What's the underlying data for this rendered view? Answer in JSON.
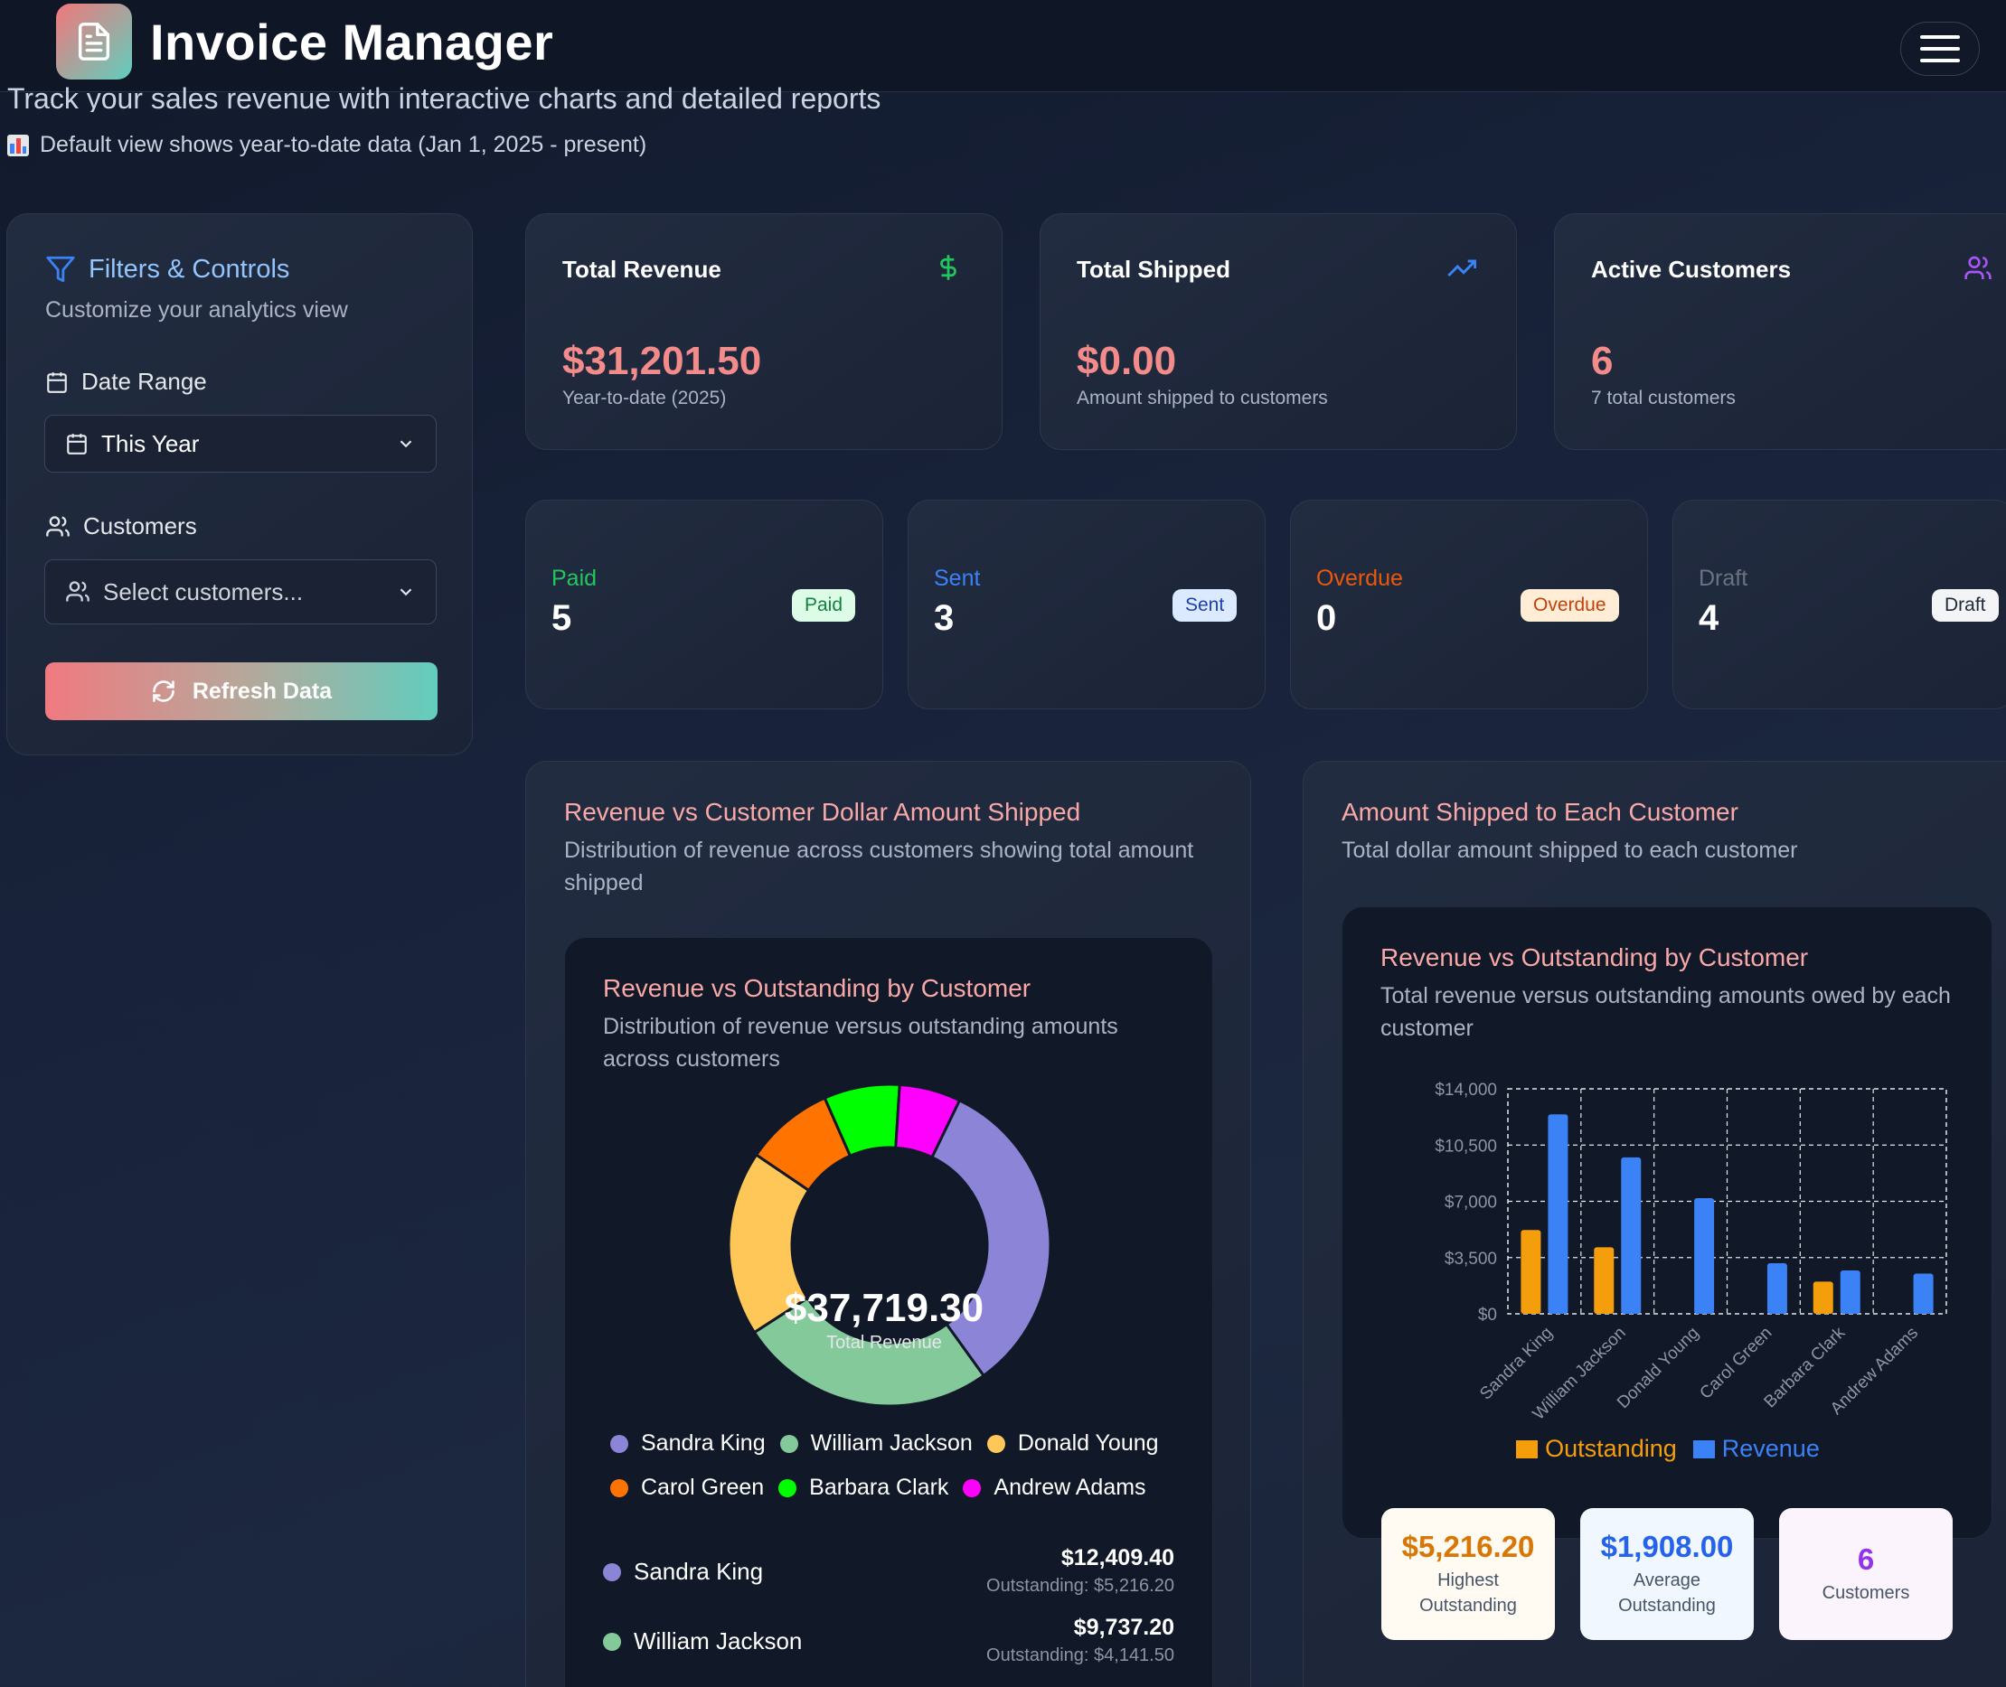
{
  "app": {
    "title": "Invoice Manager"
  },
  "header": {
    "subtitle": "Track your sales revenue with interactive charts and detailed reports",
    "note": "Default view shows year-to-date data (Jan 1, 2025 - present)"
  },
  "filters": {
    "title": "Filters & Controls",
    "subtitle": "Customize your analytics view",
    "date_range_label": "Date Range",
    "date_range_value": "This Year",
    "customers_label": "Customers",
    "customers_placeholder": "Select customers...",
    "refresh_label": "Refresh Data"
  },
  "stats": [
    {
      "title": "Total Revenue",
      "value": "$31,201.50",
      "footer": "Year-to-date (2025)",
      "icon": "dollar-icon",
      "icon_color": "#22c55e"
    },
    {
      "title": "Total Shipped",
      "value": "$0.00",
      "footer": "Amount shipped to customers",
      "icon": "trending-up-icon",
      "icon_color": "#3b82f6"
    },
    {
      "title": "Active Customers",
      "value": "6",
      "footer": "7 total customers",
      "icon": "users-icon",
      "icon_color": "#a855f7"
    }
  ],
  "statuses": [
    {
      "label": "Paid",
      "count": "5",
      "badge": "Paid",
      "color": "#22c55e"
    },
    {
      "label": "Sent",
      "count": "3",
      "badge": "Sent",
      "color": "#3b82f6"
    },
    {
      "label": "Overdue",
      "count": "0",
      "badge": "Overdue",
      "color": "#ea580c"
    },
    {
      "label": "Draft",
      "count": "4",
      "badge": "Draft",
      "color": "#6b7280"
    }
  ],
  "left_panel": {
    "title": "Revenue vs Customer Dollar Amount Shipped",
    "subtitle_line1": "Distribution of revenue across customers showing total amount",
    "subtitle_line2": "shipped",
    "inner_title": "Revenue vs Outstanding by Customer",
    "inner_sub_line1": "Distribution of revenue versus outstanding amounts",
    "inner_sub_line2": "across customers",
    "donut_total": "$37,719.30",
    "donut_total_label": "Total Revenue",
    "customers": [
      {
        "name": "Sandra King",
        "value": "$12,409.40",
        "outstanding": "Outstanding: $5,216.20"
      },
      {
        "name": "William Jackson",
        "value": "$9,737.20",
        "outstanding": "Outstanding: $4,141.50"
      }
    ]
  },
  "right_panel": {
    "title": "Amount Shipped to Each Customer",
    "subtitle": "Total dollar amount shipped to each customer",
    "inner_title": "Revenue vs Outstanding by Customer",
    "inner_sub_line1": "Total revenue versus outstanding amounts owed by each",
    "inner_sub_line2": "customer",
    "summary": [
      {
        "value": "$5,216.20",
        "label_line1": "Highest",
        "label_line2": "Outstanding",
        "color": "#d97706",
        "bg": "#fffaf2"
      },
      {
        "value": "$1,908.00",
        "label_line1": "Average",
        "label_line2": "Outstanding",
        "color": "#2563eb",
        "bg": "#f1f7ff"
      },
      {
        "value": "6",
        "label_line1": "Customers",
        "label_line2": "",
        "color": "#9333ea",
        "bg": "#fbf4fd"
      }
    ]
  },
  "chart_data": [
    {
      "type": "pie",
      "variant": "donut",
      "categories": [
        "Sandra King",
        "William Jackson",
        "Donald Young",
        "Carol Green",
        "Barbara Clark",
        "Andrew Adams"
      ],
      "values": [
        12409.4,
        9737.2,
        7020.0,
        3360.0,
        2870.0,
        2322.7
      ],
      "colors": [
        "#8b84d7",
        "#84c99a",
        "#ffc658",
        "#ff7300",
        "#00ff00",
        "#ff00ff"
      ],
      "legend": "bottom"
    },
    {
      "type": "bar",
      "categories": [
        "Sandra King",
        "William Jackson",
        "Donald Young",
        "Carol Green",
        "Barbara Clark",
        "Andrew Adams"
      ],
      "series": [
        {
          "name": "Outstanding",
          "color": "#f59e0b",
          "values": [
            5216.2,
            4141.5,
            0,
            0,
            2000,
            0
          ]
        },
        {
          "name": "Revenue",
          "color": "#3b82f6",
          "values": [
            12409.4,
            9737.2,
            7200,
            3150,
            2700,
            2500
          ]
        }
      ],
      "ylim": [
        0,
        14000
      ],
      "yticks": [
        "$0",
        "$3,500",
        "$7,000",
        "$10,500",
        "$14,000"
      ],
      "yticks_values": [
        0,
        3500,
        7000,
        10500,
        14000
      ],
      "grid": true,
      "legend": "bottom"
    }
  ]
}
